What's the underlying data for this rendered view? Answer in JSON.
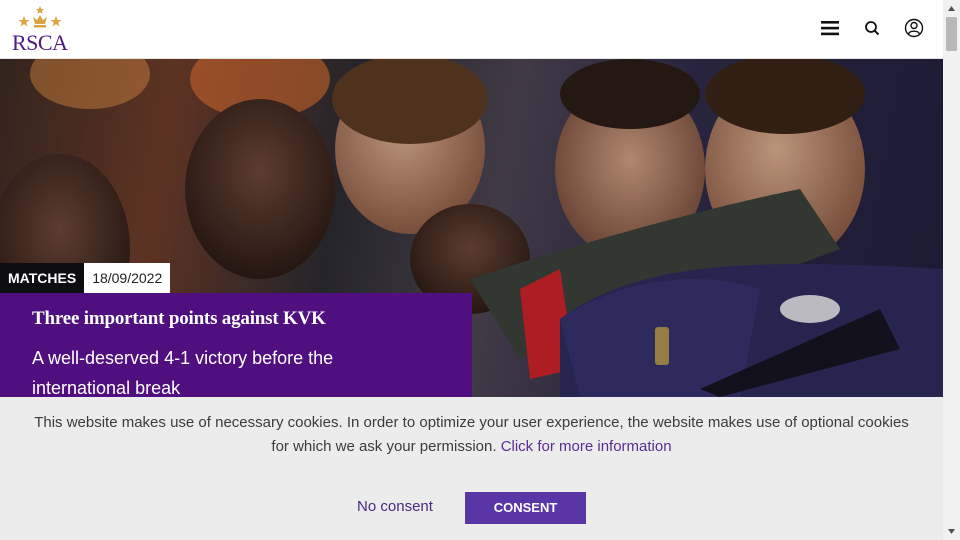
{
  "header": {
    "logo_text": "RSCA",
    "icons": [
      "menu-icon",
      "search-icon",
      "user-icon"
    ]
  },
  "hero": {
    "category": "MATCHES",
    "date": "18/09/2022",
    "title": "Three important points against KVK",
    "subtitle": "A well-deserved 4-1 victory before the international break"
  },
  "cookie_banner": {
    "message": "This website makes use of necessary cookies. In order to optimize your user experience, the website makes use of optional cookies for which we ask your permission.",
    "link_text": "Click for more information",
    "no_consent_label": "No consent",
    "consent_label": "CONSENT"
  },
  "colors": {
    "brand_purple": "#4f0f7f",
    "button_purple": "#5a35a6",
    "gold": "#d9a441"
  }
}
